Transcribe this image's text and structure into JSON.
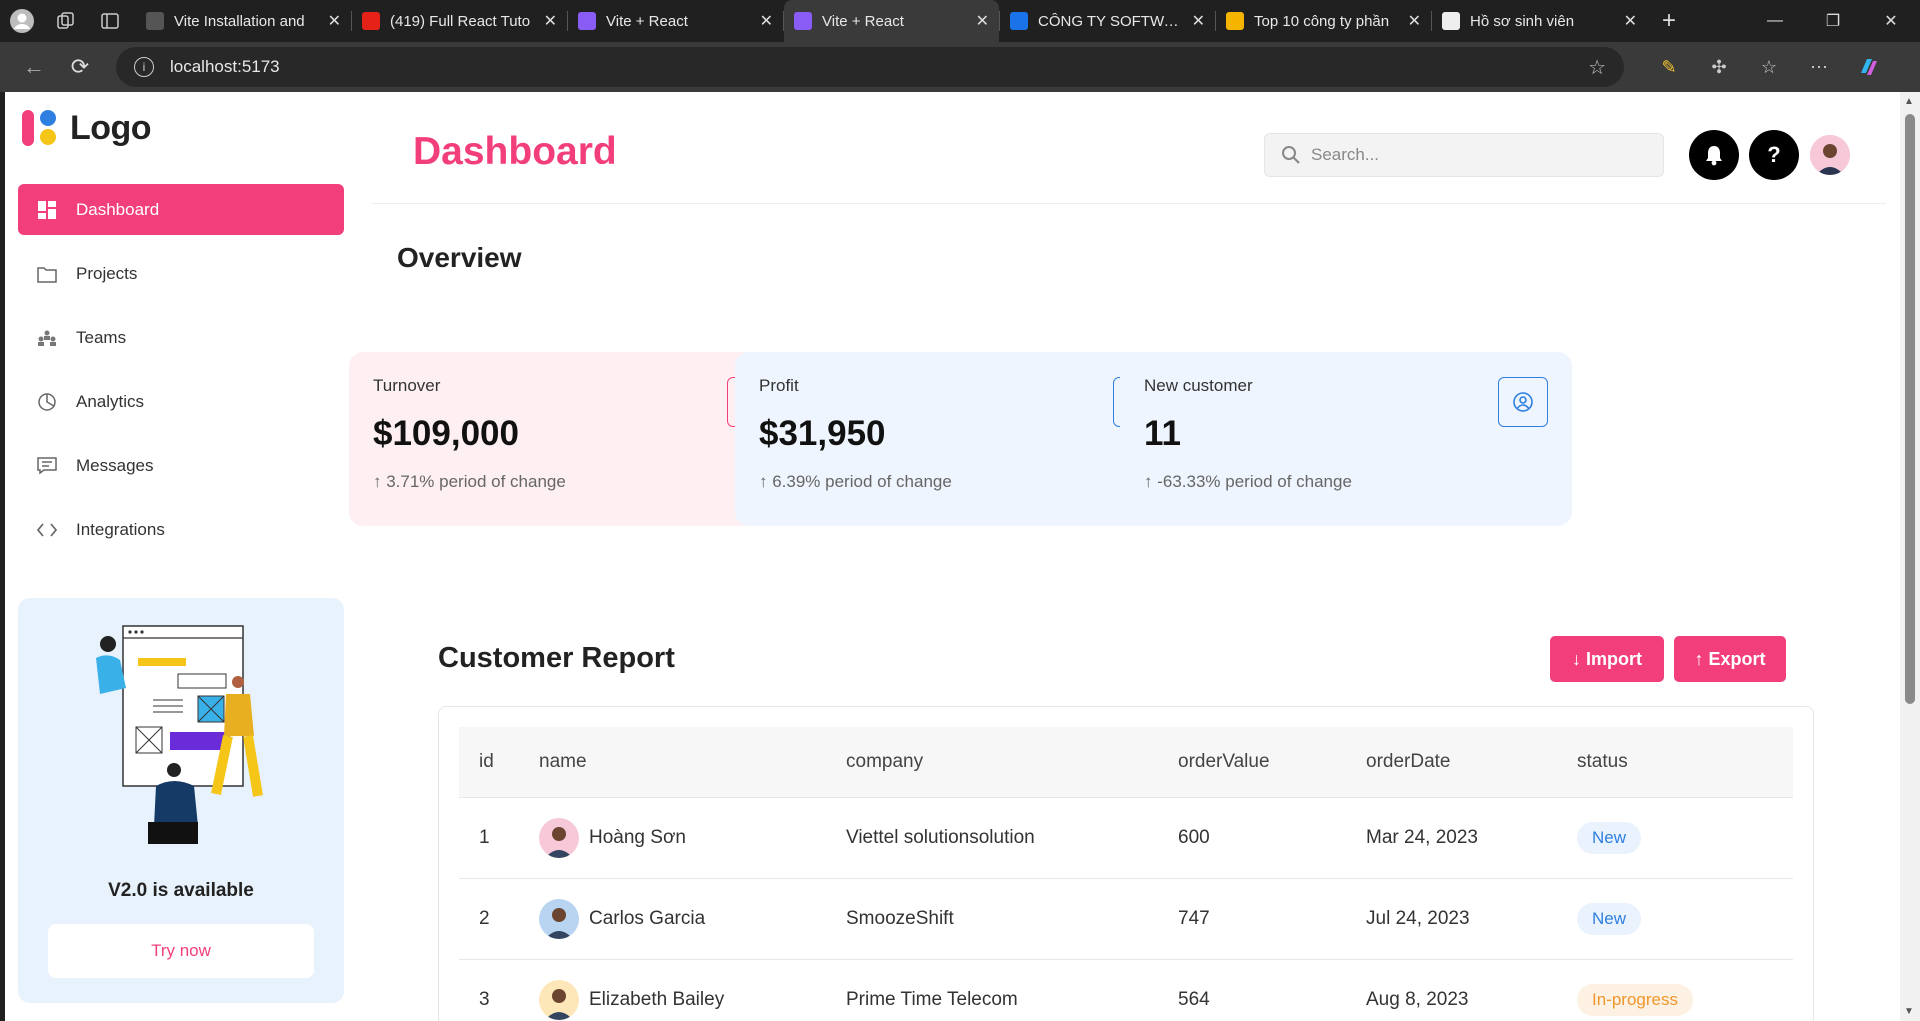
{
  "browser": {
    "tabs": [
      {
        "title": "Vite Installation and",
        "favicon_color": "#555555"
      },
      {
        "title": "(419) Full React Tuto",
        "favicon_color": "#e62117"
      },
      {
        "title": "Vite + React",
        "favicon_color": "#8a5cf6"
      },
      {
        "title": "Vite + React",
        "favicon_color": "#8a5cf6"
      },
      {
        "title": "CÔNG TY SOFTWAR",
        "favicon_color": "#1a73e8"
      },
      {
        "title": "Top 10 công ty phần",
        "favicon_color": "#f4b400"
      },
      {
        "title": "Hồ sơ sinh viên",
        "favicon_color": "#eeeeee"
      }
    ],
    "active_tab": 3,
    "url": "localhost:5173"
  },
  "sidebar": {
    "logo_text": "Logo",
    "items": [
      {
        "label": "Dashboard",
        "icon": "dashboard-icon",
        "active": true
      },
      {
        "label": "Projects",
        "icon": "folder-icon"
      },
      {
        "label": "Teams",
        "icon": "teams-icon"
      },
      {
        "label": "Analytics",
        "icon": "pie-chart-icon"
      },
      {
        "label": "Messages",
        "icon": "message-icon"
      },
      {
        "label": "Integrations",
        "icon": "code-icon"
      }
    ],
    "promo": {
      "title": "V2.0 is available",
      "button": "Try now"
    }
  },
  "header": {
    "title": "Dashboard",
    "search_placeholder": "Search...",
    "help_label": "?"
  },
  "overview": {
    "title": "Overview",
    "cards": [
      {
        "label": "Turnover",
        "value": "$109,000",
        "change": "↑ 3.71% period of change",
        "icon": "cart-icon",
        "bg": "#fef0f2",
        "accent": "#f23f7c"
      },
      {
        "label": "Profit",
        "value": "$31,950",
        "change": "↑ 6.39% period of change",
        "icon": "dollar-icon",
        "icon_text": "$",
        "bg": "#eff5fe",
        "accent": "#2f7fe0"
      },
      {
        "label": "New customer",
        "value": "11",
        "change": "↑ -63.33% period of change",
        "icon": "user-circle-icon",
        "bg": "#eff5fe",
        "accent": "#2f7fe0"
      }
    ]
  },
  "report": {
    "title": "Customer Report",
    "import_label": "↓ Import",
    "export_label": "↑ Export",
    "columns": [
      "id",
      "name",
      "company",
      "orderValue",
      "orderDate",
      "status"
    ],
    "rows": [
      {
        "id": "1",
        "name": "Hoàng Sơn",
        "company": "Viettel solutionsolution",
        "orderValue": "600",
        "orderDate": "Mar 24, 2023",
        "status": "New"
      },
      {
        "id": "2",
        "name": "Carlos Garcia",
        "company": "SmoozeShift",
        "orderValue": "747",
        "orderDate": "Jul 24, 2023",
        "status": "New"
      },
      {
        "id": "3",
        "name": "Elizabeth Bailey",
        "company": "Prime Time Telecom",
        "orderValue": "564",
        "orderDate": "Aug 8, 2023",
        "status": "In-progress"
      }
    ],
    "status_colors": {
      "New": {
        "bg": "#eaf3fd",
        "fg": "#2f7fe0"
      },
      "In-progress": {
        "bg": "#fdf1e3",
        "fg": "#f0962c"
      }
    }
  }
}
